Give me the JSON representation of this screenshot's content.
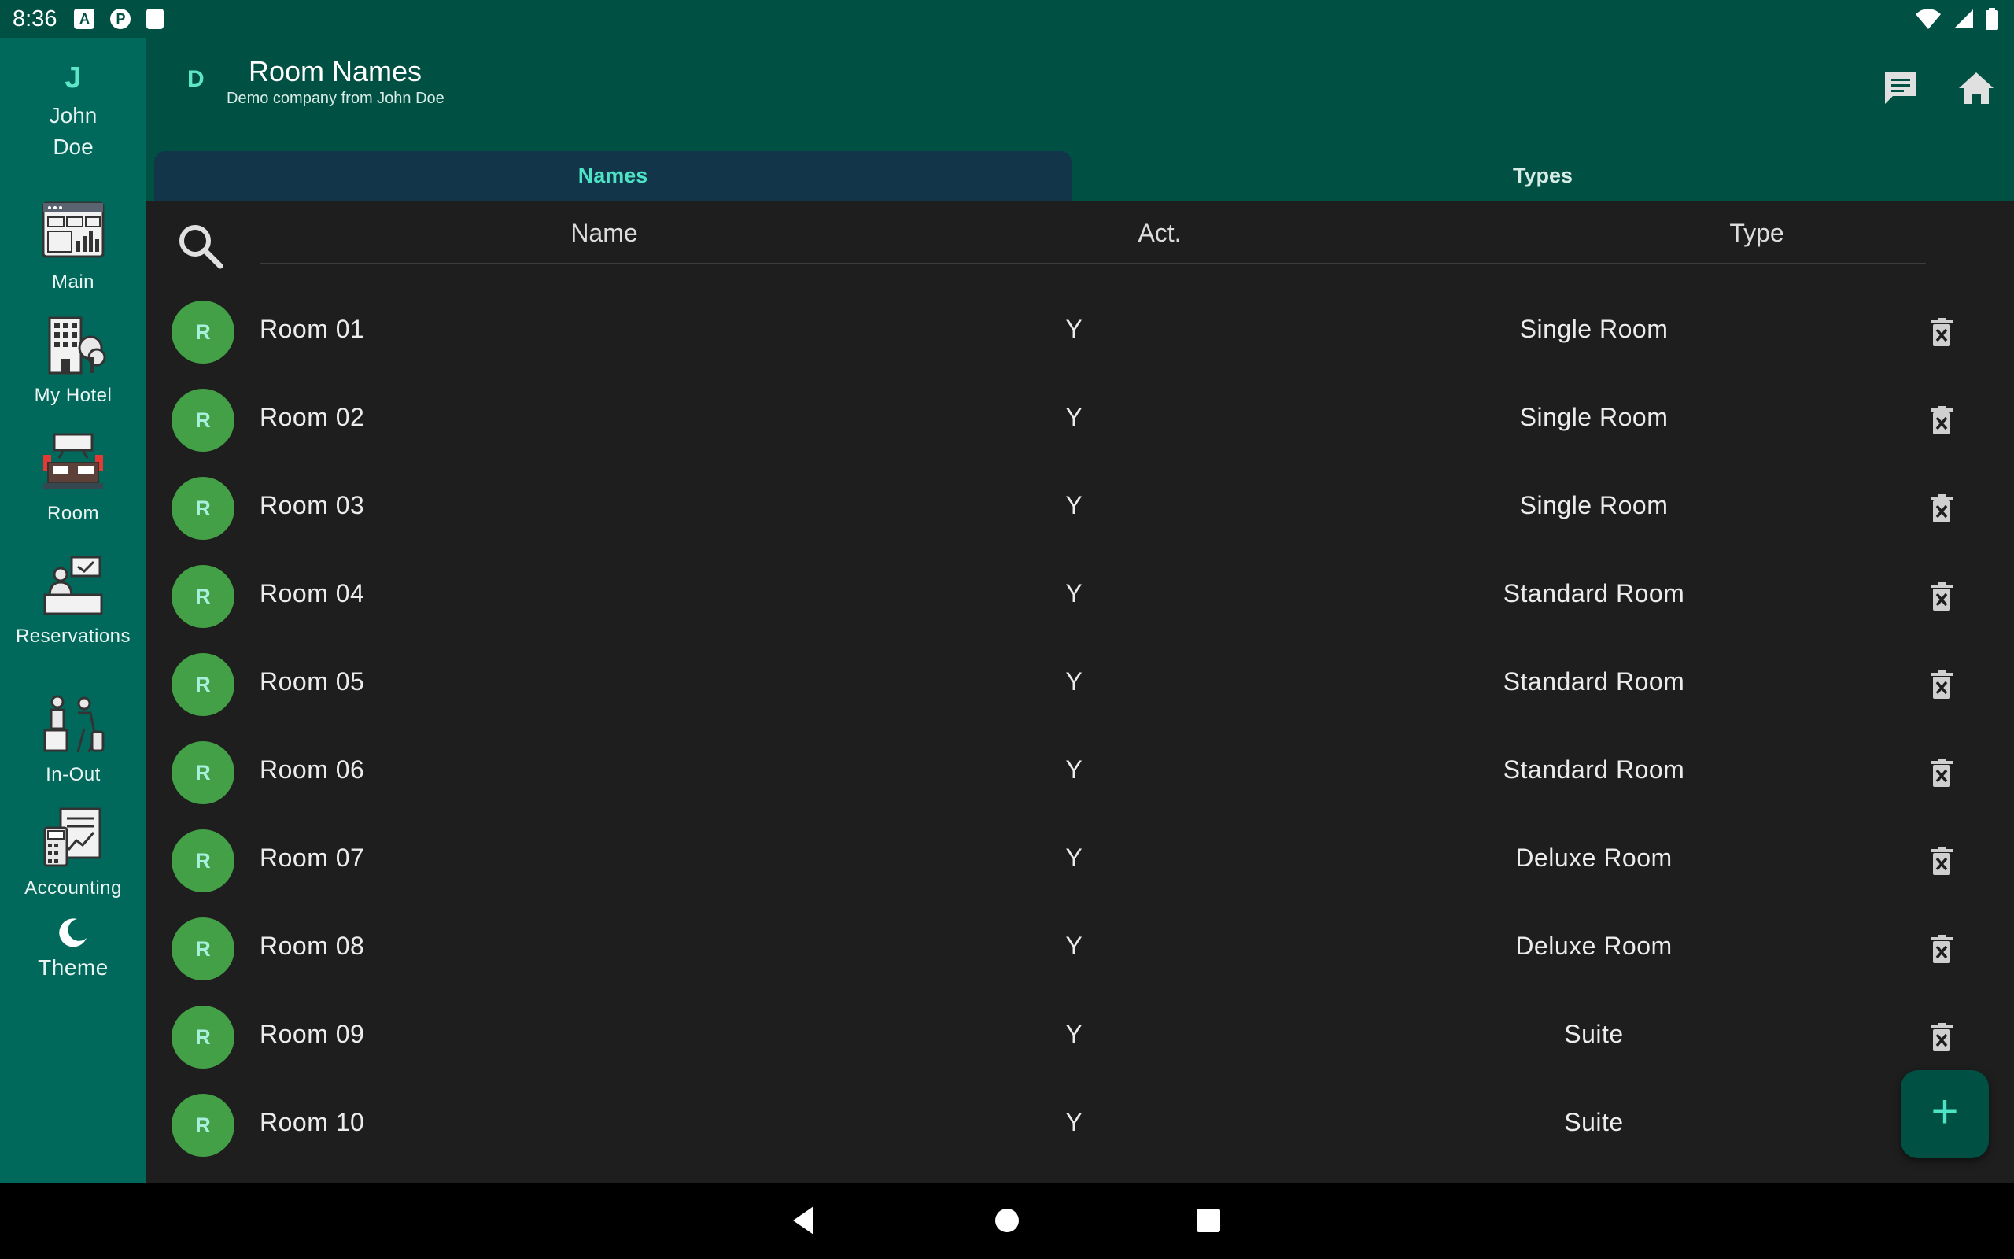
{
  "status_bar": {
    "time": "8:36",
    "icons": [
      "a-icon",
      "p-icon",
      "sd-card-icon",
      "wifi-icon",
      "signal-icon",
      "battery-icon"
    ]
  },
  "rail": {
    "user_initial": "J",
    "user_name": "John Doe",
    "items": [
      {
        "label": "Main",
        "icon": "dashboard-icon"
      },
      {
        "label": "My Hotel",
        "icon": "hotel-icon"
      },
      {
        "label": "Room",
        "icon": "room-bed-icon"
      },
      {
        "label": "Reservations",
        "icon": "reception-desk-icon"
      },
      {
        "label": "In-Out",
        "icon": "check-in-out-icon"
      },
      {
        "label": "Accounting",
        "icon": "accounting-icon"
      },
      {
        "label": "Theme",
        "icon": "moon-icon"
      }
    ]
  },
  "appbar": {
    "company_initial": "D",
    "title": "Room Names",
    "subtitle": "Demo company from John Doe"
  },
  "tabs": [
    {
      "label": "Names",
      "active": true
    },
    {
      "label": "Types",
      "active": false
    }
  ],
  "table": {
    "headers": {
      "name": "Name",
      "active": "Act.",
      "type": "Type"
    },
    "rows": [
      {
        "initial": "R",
        "name": "Room 01",
        "active": "Y",
        "type": "Single Room"
      },
      {
        "initial": "R",
        "name": "Room 02",
        "active": "Y",
        "type": "Single Room"
      },
      {
        "initial": "R",
        "name": "Room 03",
        "active": "Y",
        "type": "Single Room"
      },
      {
        "initial": "R",
        "name": "Room 04",
        "active": "Y",
        "type": "Standard Room"
      },
      {
        "initial": "R",
        "name": "Room 05",
        "active": "Y",
        "type": "Standard Room"
      },
      {
        "initial": "R",
        "name": "Room 06",
        "active": "Y",
        "type": "Standard Room"
      },
      {
        "initial": "R",
        "name": "Room 07",
        "active": "Y",
        "type": "Deluxe Room"
      },
      {
        "initial": "R",
        "name": "Room 08",
        "active": "Y",
        "type": "Deluxe Room"
      },
      {
        "initial": "R",
        "name": "Room 09",
        "active": "Y",
        "type": "Suite"
      },
      {
        "initial": "R",
        "name": "Room 10",
        "active": "Y",
        "type": "Suite"
      }
    ]
  },
  "fab": {
    "label": "+"
  },
  "colors": {
    "primary": "#005043",
    "rail": "#00695c",
    "accent": "#4fe3c6",
    "avatar": "#43a047",
    "surface": "#1e1e1e"
  }
}
